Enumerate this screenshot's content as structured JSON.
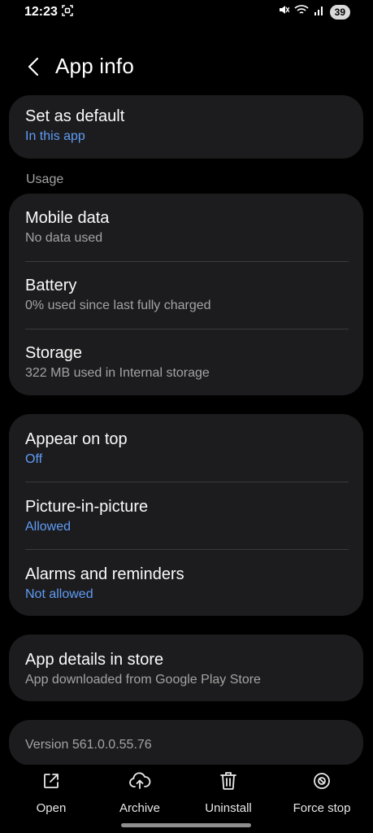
{
  "status": {
    "time": "12:23",
    "battery": "39"
  },
  "header": {
    "title": "App info"
  },
  "default_card": {
    "title": "Set as default",
    "subtitle": "In this app"
  },
  "usage": {
    "label": "Usage",
    "items": [
      {
        "title": "Mobile data",
        "subtitle": "No data used"
      },
      {
        "title": "Battery",
        "subtitle": "0% used since last fully charged"
      },
      {
        "title": "Storage",
        "subtitle": "322 MB used in Internal storage"
      }
    ]
  },
  "permissions": {
    "items": [
      {
        "title": "Appear on top",
        "subtitle": "Off"
      },
      {
        "title": "Picture-in-picture",
        "subtitle": "Allowed"
      },
      {
        "title": "Alarms and reminders",
        "subtitle": "Not allowed"
      }
    ]
  },
  "store": {
    "title": "App details in store",
    "subtitle": "App downloaded from Google Play Store"
  },
  "version": {
    "text": "Version 561.0.0.55.76"
  },
  "actions": [
    {
      "label": "Open",
      "icon": "open-external-icon"
    },
    {
      "label": "Archive",
      "icon": "cloud-upload-icon"
    },
    {
      "label": "Uninstall",
      "icon": "trash-icon"
    },
    {
      "label": "Force stop",
      "icon": "stop-circle-icon"
    }
  ],
  "colors": {
    "background": "#000000",
    "card": "#1c1c1e",
    "accent": "#5f9cf5",
    "secondary_text": "#a3a3a3"
  }
}
